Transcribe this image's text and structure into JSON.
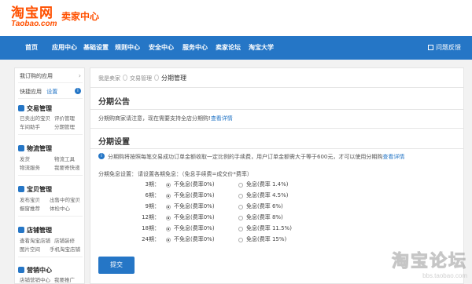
{
  "header": {
    "logo_cn": "淘宝网",
    "logo_en": "Taobao.com",
    "site_title": "卖家中心"
  },
  "nav": {
    "items": [
      "首页",
      "应用中心",
      "基础设置",
      "规则中心",
      "安全中心",
      "服务中心",
      "卖家论坛",
      "淘宝大学"
    ],
    "feedback": "问题反馈"
  },
  "sidebar": {
    "my_apps": "我订购的应用",
    "quick_apps": "快捷应用",
    "settings": "设置",
    "groups": [
      {
        "title": "交易管理",
        "subs": [
          [
            "已卖出的宝贝",
            "评价管理"
          ],
          [
            "车间助手",
            "分期管理"
          ]
        ]
      },
      {
        "title": "物流管理",
        "subs": [
          [
            "发货",
            "物流工具"
          ],
          [
            "物流服务",
            "我要寄快递"
          ]
        ]
      },
      {
        "title": "宝贝管理",
        "subs": [
          [
            "发布宝贝",
            "出售中的宝贝"
          ],
          [
            "橱窗推荐",
            "体检中心"
          ]
        ]
      },
      {
        "title": "店铺管理",
        "subs": [
          [
            "查看淘宝店铺",
            "店铺装修"
          ],
          [
            "图片空间",
            "手机淘宝店铺"
          ]
        ]
      },
      {
        "title": "营销中心",
        "subs": [
          [
            "店铺营销中心",
            "我要推广"
          ]
        ]
      }
    ]
  },
  "breadcrumb": {
    "root": "我是卖家",
    "middle": "交易管理",
    "current": "分期管理"
  },
  "notice": {
    "title": "分期公告",
    "text": "分期购商家请注意，现在需要支持全店分期购!",
    "link": "查看详情"
  },
  "settings": {
    "title": "分期设置",
    "info_text": "分期购将按照每笔交易成功订单金额收取一定比例的手续费，用户订单金额需大于等于600元，才可以使用分期购",
    "info_link": "查看详情",
    "label": "分期免息设置：",
    "formula": "请设置各期免息：（免息手续费=成交价*费率）",
    "rows": [
      {
        "period": "3期：",
        "free": "不免息(费率0%)",
        "rate": "免息(费率 1.4%)"
      },
      {
        "period": "6期：",
        "free": "不免息(费率0%)",
        "rate": "免息(费率 4.5%)"
      },
      {
        "period": "9期：",
        "free": "不免息(费率0%)",
        "rate": "免息(费率 6%)"
      },
      {
        "period": "12期：",
        "free": "不免息(费率0%)",
        "rate": "免息(费率 8%)"
      },
      {
        "period": "18期：",
        "free": "不免息(费率0%)",
        "rate": "免息(费率 11.5%)"
      },
      {
        "period": "24期：",
        "free": "不免息(费率0%)",
        "rate": "免息(费率 15%)"
      }
    ],
    "submit": "提交"
  },
  "watermark": {
    "line1": "淘宝论坛",
    "line2": "bbs.taobao.com"
  },
  "colors": {
    "brand": "#ff5000",
    "nav": "#2576c6"
  }
}
